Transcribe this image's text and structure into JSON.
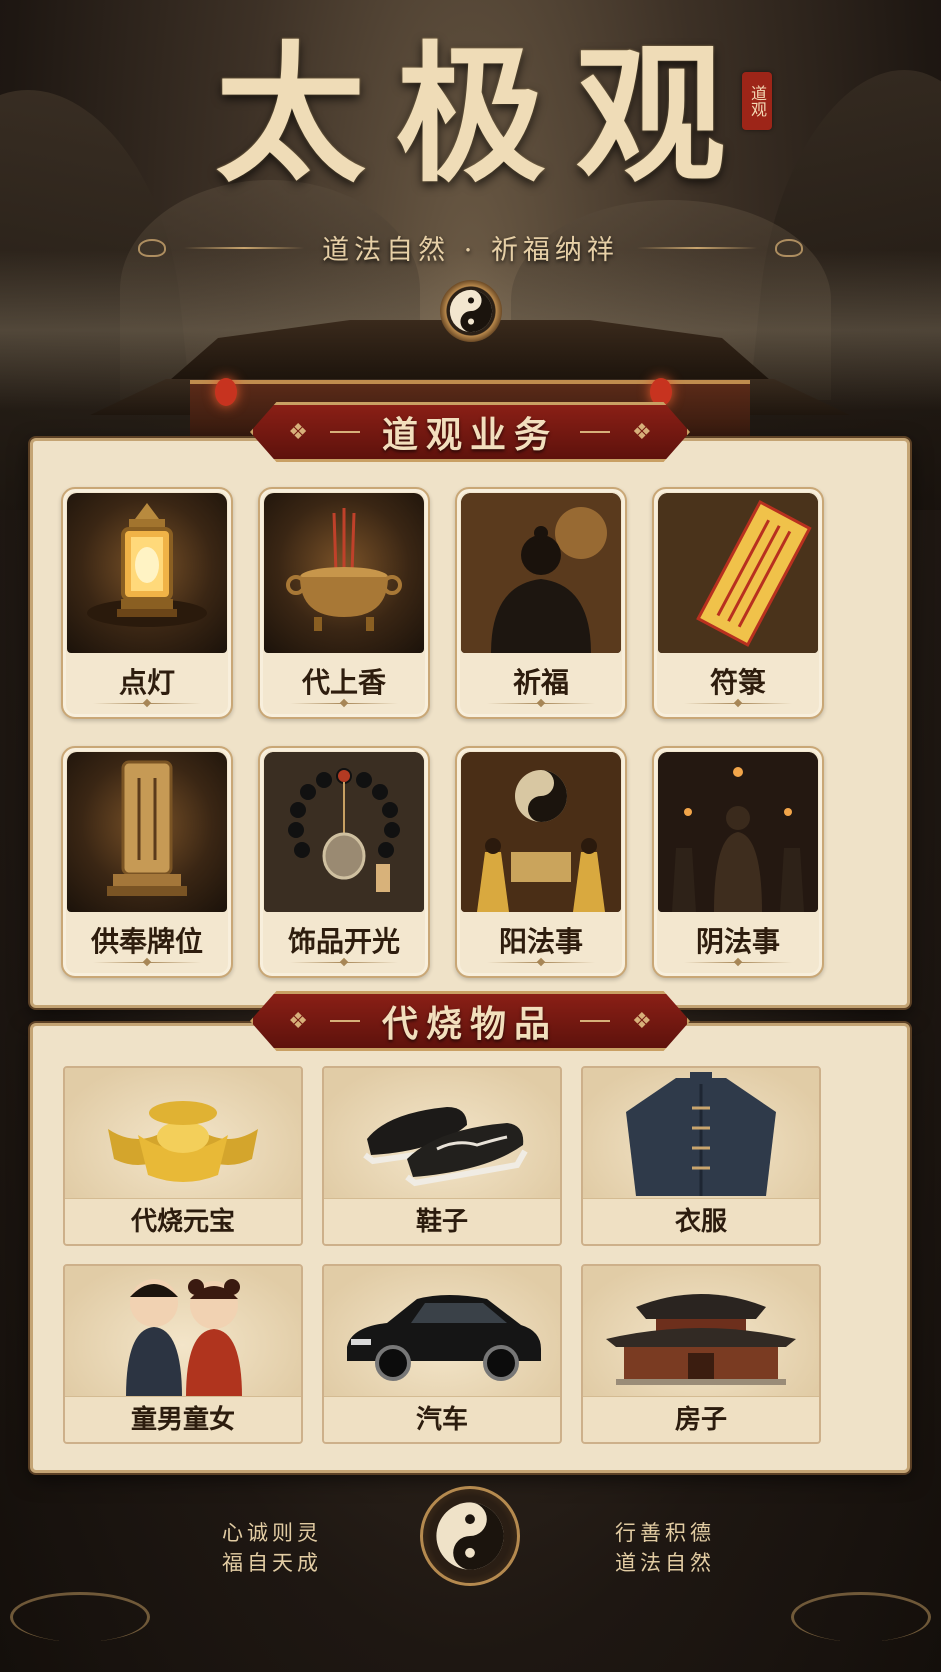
{
  "header": {
    "title": "太极观",
    "seal": "道观",
    "subtitle": "道法自然 · 祈福纳祥"
  },
  "services": {
    "heading": "道观业务",
    "items": [
      {
        "label": "点灯",
        "icon": "lantern-icon"
      },
      {
        "label": "代上香",
        "icon": "incense-burner-icon"
      },
      {
        "label": "祈福",
        "icon": "praying-person-icon"
      },
      {
        "label": "符箓",
        "icon": "talisman-icon"
      },
      {
        "label": "供奉牌位",
        "icon": "memorial-tablet-icon"
      },
      {
        "label": "饰品开光",
        "icon": "prayer-beads-icon"
      },
      {
        "label": "阳法事",
        "icon": "yang-ritual-icon"
      },
      {
        "label": "阴法事",
        "icon": "yin-ritual-icon"
      }
    ]
  },
  "burn_items": {
    "heading": "代烧物品",
    "items": [
      {
        "label": "代烧元宝",
        "icon": "gold-ingot-icon"
      },
      {
        "label": "鞋子",
        "icon": "shoes-icon"
      },
      {
        "label": "衣服",
        "icon": "clothing-icon"
      },
      {
        "label": "童男童女",
        "icon": "boy-girl-figures-icon"
      },
      {
        "label": "汽车",
        "icon": "car-icon"
      },
      {
        "label": "房子",
        "icon": "house-icon"
      }
    ]
  },
  "footer": {
    "left_line1": "心诚则灵",
    "left_line2": "福自天成",
    "right_line1": "行善积德",
    "right_line2": "道法自然"
  },
  "colors": {
    "banner_red": "#8a1f16",
    "panel_cream": "#efe2c8",
    "gold": "#c9a064",
    "dark_bg": "#1c1510"
  }
}
